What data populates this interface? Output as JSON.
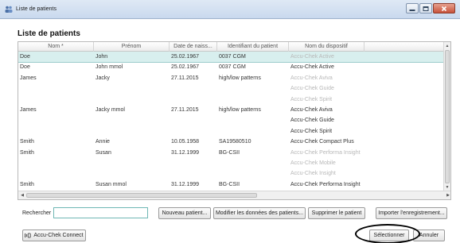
{
  "window": {
    "title": "Liste de patients"
  },
  "heading": "Liste de patients",
  "table": {
    "columns": [
      "Nom *",
      "Prénom",
      "Date de naiss...",
      "Identifiant du patient",
      "Nom du dispositif"
    ],
    "rows": [
      {
        "nom": "Doe",
        "prenom": "John",
        "date": "25.02.1967",
        "id": "0037 CGM",
        "device": "Accu-Chek Active",
        "device_greyed": true,
        "selected": true
      },
      {
        "nom": "Doe",
        "prenom": "John mmol",
        "date": "25.02.1967",
        "id": "0037 CGM",
        "device": "Accu-Chek Active",
        "device_greyed": false,
        "selected": false
      },
      {
        "nom": "James",
        "prenom": "Jacky",
        "date": "27.11.2015",
        "id": "high/low patterns",
        "device": "Accu-Chek Aviva",
        "device_greyed": true,
        "selected": false
      },
      {
        "nom": "",
        "prenom": "",
        "date": "",
        "id": "",
        "device": "Accu-Chek Guide",
        "device_greyed": true,
        "selected": false
      },
      {
        "nom": "",
        "prenom": "",
        "date": "",
        "id": "",
        "device": "Accu-Chek Spirit",
        "device_greyed": true,
        "selected": false
      },
      {
        "nom": "James",
        "prenom": "Jacky mmol",
        "date": "27.11.2015",
        "id": "high/low patterns",
        "device": "Accu-Chek Aviva",
        "device_greyed": false,
        "selected": false
      },
      {
        "nom": "",
        "prenom": "",
        "date": "",
        "id": "",
        "device": "Accu-Chek Guide",
        "device_greyed": false,
        "selected": false
      },
      {
        "nom": "",
        "prenom": "",
        "date": "",
        "id": "",
        "device": "Accu-Chek Spirit",
        "device_greyed": false,
        "selected": false
      },
      {
        "nom": "Smith",
        "prenom": "Annie",
        "date": "10.05.1958",
        "id": "SA19580510",
        "device": "Accu-Chek Compact Plus",
        "device_greyed": false,
        "selected": false
      },
      {
        "nom": "Smith",
        "prenom": "Susan",
        "date": "31.12.1999",
        "id": "BG-CSII",
        "device": "Accu-Chek Performa Insight",
        "device_greyed": true,
        "selected": false
      },
      {
        "nom": "",
        "prenom": "",
        "date": "",
        "id": "",
        "device": "Accu-Chek Mobile",
        "device_greyed": true,
        "selected": false
      },
      {
        "nom": "",
        "prenom": "",
        "date": "",
        "id": "",
        "device": "Accu-Chek Insight",
        "device_greyed": true,
        "selected": false
      },
      {
        "nom": "Smith",
        "prenom": "Susan mmol",
        "date": "31.12.1999",
        "id": "BG-CSII",
        "device": "Accu-Chek Performa Insight",
        "device_greyed": false,
        "selected": false
      }
    ]
  },
  "search": {
    "label": "Rechercher",
    "value": ""
  },
  "buttons": {
    "new_patient": "Nouveau patient...",
    "modify_patient": "Modifier les données des patients...",
    "delete_patient": "Supprimer le patient",
    "import_record": "Importer l'enregistrement...",
    "connect": "Accu-Chek Connect",
    "select": "Sélectionner",
    "cancel": "Annuler"
  },
  "colors": {
    "selected_row": "#d8efee",
    "search_border": "#6fb7b4"
  },
  "icons": [
    "patients-icon",
    "minimize-icon",
    "maximize-icon",
    "close-icon",
    "connect-icon"
  ]
}
